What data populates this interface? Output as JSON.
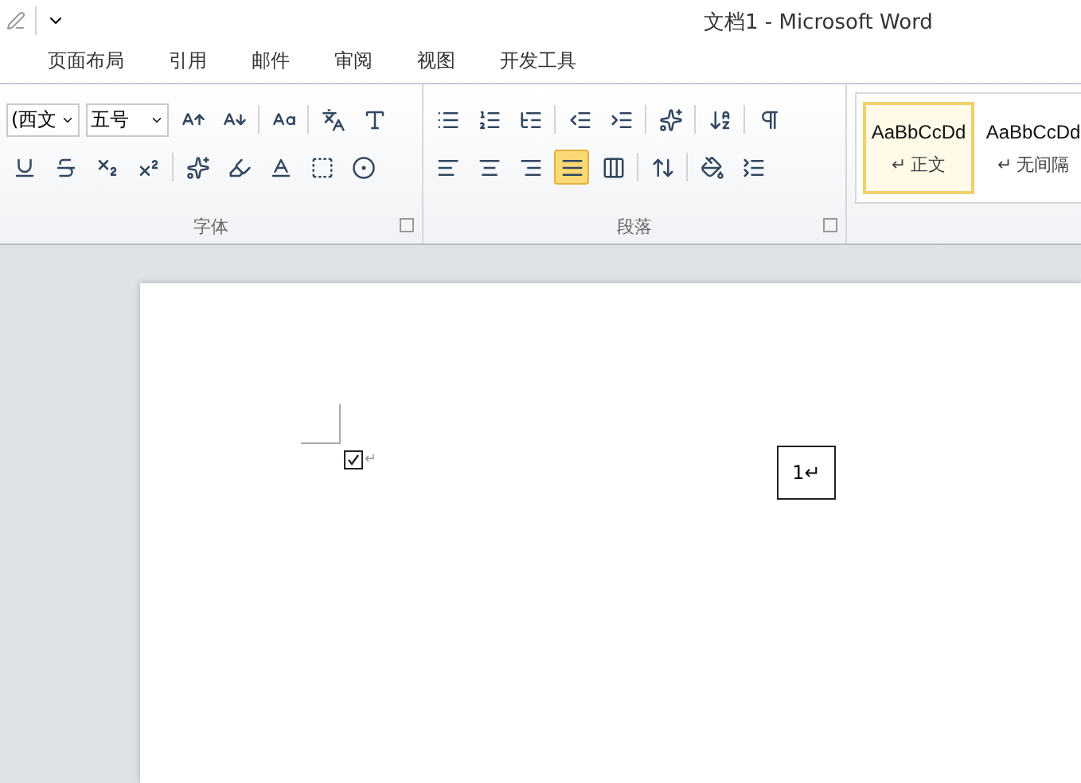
{
  "window": {
    "title": "文档1 - Microsoft Word"
  },
  "tabs": [
    {
      "label": "页面布局",
      "selected": false
    },
    {
      "label": "引用",
      "selected": false
    },
    {
      "label": "邮件",
      "selected": false
    },
    {
      "label": "审阅",
      "selected": false
    },
    {
      "label": "视图",
      "selected": false
    },
    {
      "label": "开发工具",
      "selected": false
    }
  ],
  "font_group": {
    "label": "字体",
    "font_name": "(西文",
    "font_size": "五号"
  },
  "paragraph_group": {
    "label": "段落",
    "alignment": [
      {
        "selected": false
      },
      {
        "selected": false
      },
      {
        "selected": false
      },
      {
        "selected": true
      },
      {
        "selected": false
      }
    ]
  },
  "styles": [
    {
      "sample": "AaBbCcDd",
      "name": "↵ 正文",
      "selected": true
    },
    {
      "sample": "AaBbCcDd",
      "name": "↵ 无间隔",
      "selected": false
    }
  ],
  "document": {
    "checkbox": {
      "checked": true,
      "mark": "↵"
    },
    "text_box": "1↵"
  }
}
